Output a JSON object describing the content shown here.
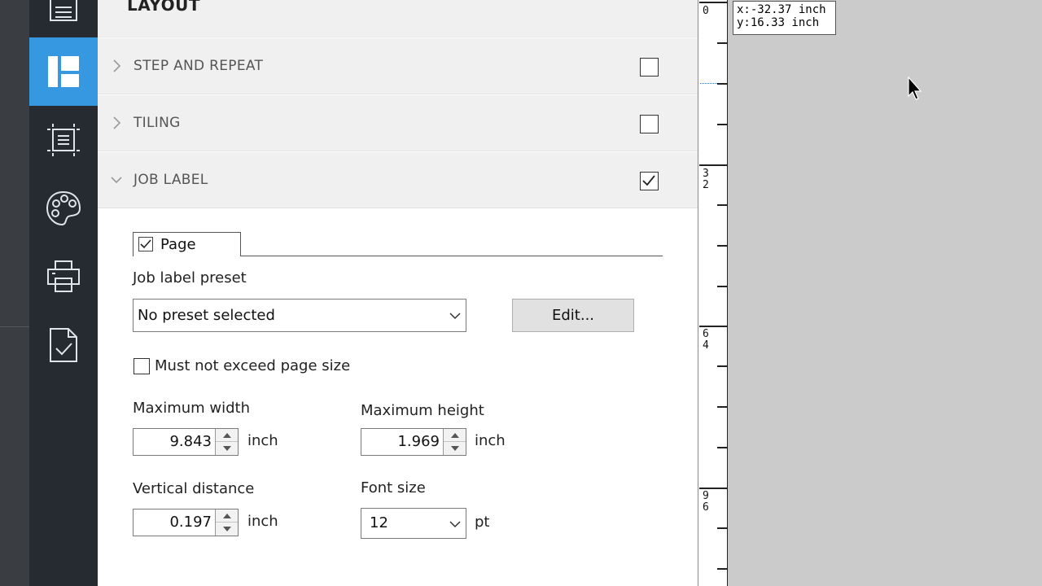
{
  "panel": {
    "title": "LAYOUT"
  },
  "sections": [
    {
      "label": "STEP AND REPEAT",
      "checked": false,
      "expanded": false
    },
    {
      "label": "TILING",
      "checked": false,
      "expanded": false
    },
    {
      "label": "JOB LABEL",
      "checked": true,
      "expanded": true
    }
  ],
  "job_label": {
    "tab_label": "Page",
    "preset_label": "Job label preset",
    "preset_value": "No preset selected",
    "edit_label": "Edit...",
    "must_not_exceed_label": "Must not exceed page size",
    "max_width_label": "Maximum width",
    "max_width_value": "9.843",
    "max_width_unit": "inch",
    "max_height_label": "Maximum height",
    "max_height_value": "1.969",
    "max_height_unit": "inch",
    "vertical_distance_label": "Vertical distance",
    "vertical_distance_value": "0.197",
    "vertical_distance_unit": "inch",
    "font_size_label": "Font size",
    "font_size_value": "12",
    "font_size_unit": "pt"
  },
  "ruler": {
    "label_0": "0",
    "label_32a": "3",
    "label_32b": "2",
    "label_64a": "6",
    "label_64b": "4",
    "label_96a": "9",
    "label_96b": "6"
  },
  "coordinates": {
    "x": "x:-32.37 inch",
    "y": "y:16.33 inch"
  },
  "rail_icons": [
    "list-icon",
    "layout-icon",
    "image-select-icon",
    "palette-icon",
    "printer-icon",
    "document-check-icon"
  ],
  "colors": {
    "accent": "#3598e0",
    "rail": "#262a31",
    "canvas": "#cbcbcb"
  }
}
